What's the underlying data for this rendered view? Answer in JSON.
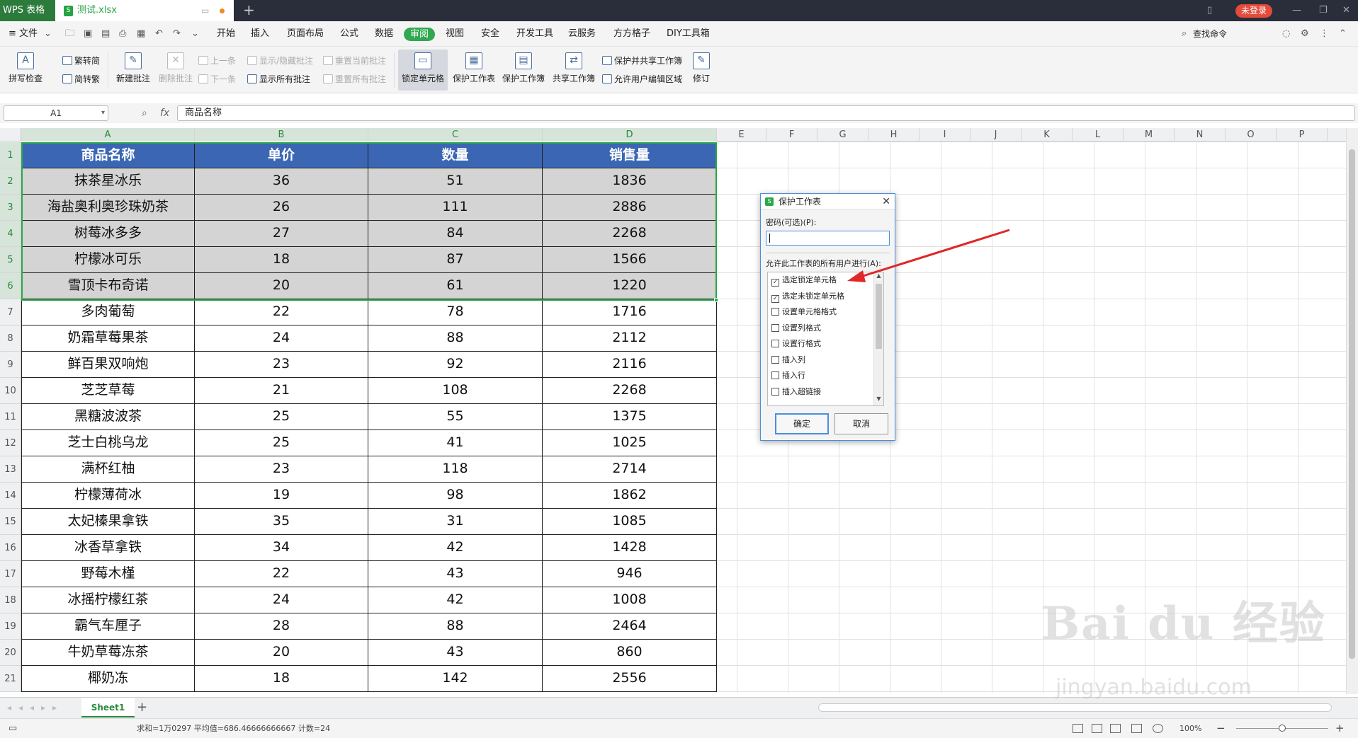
{
  "titlebar": {
    "app_tab": "WPS 表格",
    "file_tab": "测试.xlsx",
    "login": "未登录"
  },
  "menubar": {
    "file": "≡ 文件",
    "items": [
      "开始",
      "插入",
      "页面布局",
      "公式",
      "数据",
      "审阅",
      "视图",
      "安全",
      "开发工具",
      "云服务",
      "方方格子",
      "DIY工具箱"
    ],
    "active_index": 5,
    "search": "查找命令"
  },
  "ribbon": {
    "spell": "拼写检查",
    "trad": "繁转简",
    "simp": "简转繁",
    "new_comment": "新建批注",
    "del_comment": "删除批注",
    "prev": "上一条",
    "next": "下一条",
    "toggle_comment": "显示/隐藏批注",
    "show_all": "显示所有批注",
    "reset_current": "重置当前批注",
    "reset_all": "重置所有批注",
    "lock_cell": "锁定单元格",
    "protect_sheet": "保护工作表",
    "protect_book": "保护工作簿",
    "share_book": "共享工作簿",
    "protect_share": "保护并共享工作簿",
    "allow_edit": "允许用户编辑区域",
    "revise": "修订"
  },
  "formula": {
    "cell_ref": "A1",
    "fx": "fx",
    "content": "商品名称"
  },
  "columns": [
    "A",
    "B",
    "C",
    "D",
    "E",
    "F",
    "G",
    "H",
    "I",
    "J",
    "K",
    "L",
    "M",
    "N",
    "O",
    "P"
  ],
  "rows": [
    "1",
    "2",
    "3",
    "4",
    "5",
    "6",
    "7",
    "8",
    "9",
    "10",
    "11",
    "12",
    "13",
    "14",
    "15",
    "16",
    "17",
    "18",
    "19",
    "20",
    "21"
  ],
  "table": {
    "headers": [
      "商品名称",
      "单价",
      "数量",
      "销售量"
    ],
    "data": [
      [
        "抹茶星冰乐",
        "36",
        "51",
        "1836"
      ],
      [
        "海盐奥利奥珍珠奶茶",
        "26",
        "111",
        "2886"
      ],
      [
        "树莓冰多多",
        "27",
        "84",
        "2268"
      ],
      [
        "柠檬冰可乐",
        "18",
        "87",
        "1566"
      ],
      [
        "雪顶卡布奇诺",
        "20",
        "61",
        "1220"
      ],
      [
        "多肉葡萄",
        "22",
        "78",
        "1716"
      ],
      [
        "奶霜草莓果茶",
        "24",
        "88",
        "2112"
      ],
      [
        "鲜百果双响炮",
        "23",
        "92",
        "2116"
      ],
      [
        "芝芝草莓",
        "21",
        "108",
        "2268"
      ],
      [
        "黑糖波波茶",
        "25",
        "55",
        "1375"
      ],
      [
        "芝士白桃乌龙",
        "25",
        "41",
        "1025"
      ],
      [
        "满杯红柚",
        "23",
        "118",
        "2714"
      ],
      [
        "柠檬薄荷冰",
        "19",
        "98",
        "1862"
      ],
      [
        "太妃榛果拿铁",
        "35",
        "31",
        "1085"
      ],
      [
        "冰香草拿铁",
        "34",
        "42",
        "1428"
      ],
      [
        "野莓木槿",
        "22",
        "43",
        "946"
      ],
      [
        "冰摇柠檬红茶",
        "24",
        "42",
        "1008"
      ],
      [
        "霸气车厘子",
        "28",
        "88",
        "2464"
      ],
      [
        "牛奶草莓冻茶",
        "20",
        "43",
        "860"
      ],
      [
        "椰奶冻",
        "18",
        "142",
        "2556"
      ]
    ]
  },
  "dialog": {
    "title": "保护工作表",
    "password_label": "密码(可选)(P):",
    "allow_label": "允许此工作表的所有用户进行(A):",
    "options": [
      {
        "label": "选定锁定单元格",
        "checked": true
      },
      {
        "label": "选定未锁定单元格",
        "checked": true
      },
      {
        "label": "设置单元格格式",
        "checked": false
      },
      {
        "label": "设置列格式",
        "checked": false
      },
      {
        "label": "设置行格式",
        "checked": false
      },
      {
        "label": "插入列",
        "checked": false
      },
      {
        "label": "插入行",
        "checked": false
      },
      {
        "label": "插入超链接",
        "checked": false
      }
    ],
    "ok": "确定",
    "cancel": "取消"
  },
  "sheetbar": {
    "sheet": "Sheet1"
  },
  "status": {
    "summary": "求和=1万0297  平均值=686.46666666667  计数=24",
    "zoom": "100%"
  },
  "watermark": {
    "brand": "Bai du 经验",
    "url": "jingyan.baidu.com"
  },
  "colors": {
    "accent": "#2fa84f",
    "header_fill": "#3b66b4",
    "shade_fill": "#d4d4d4",
    "arrow": "#e02828"
  }
}
